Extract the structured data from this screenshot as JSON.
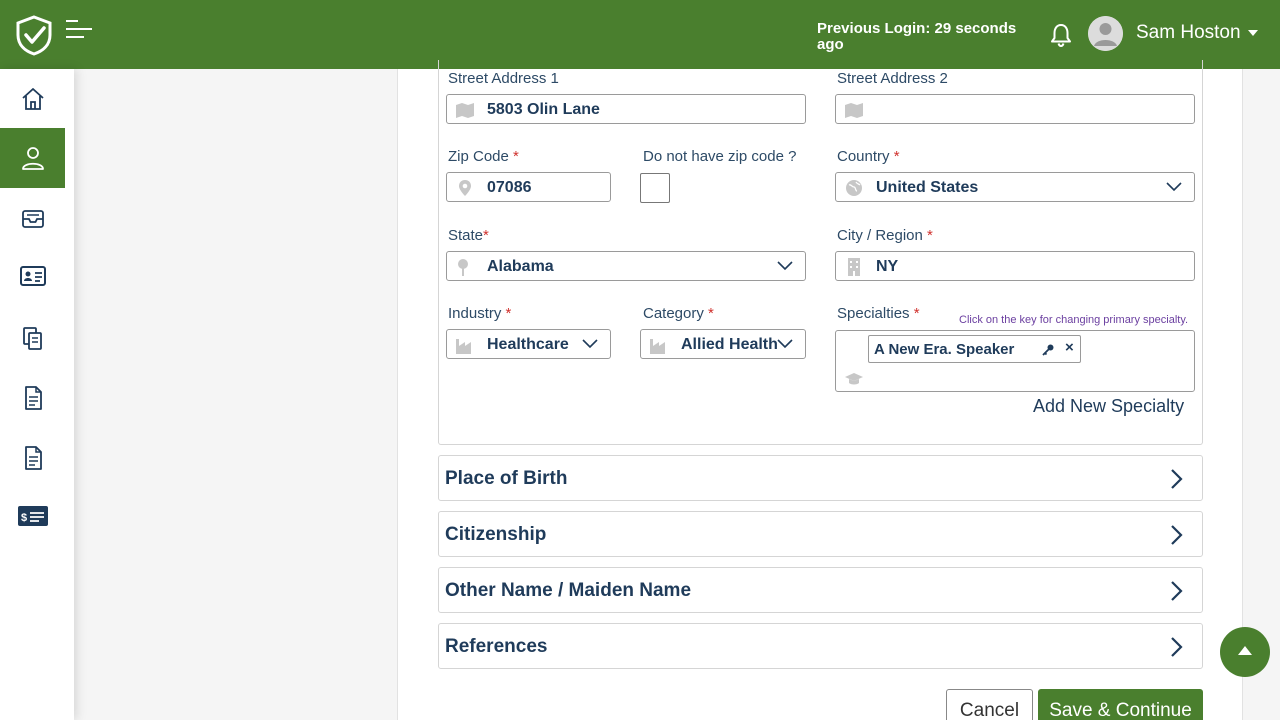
{
  "header": {
    "previous_login": "Previous Login: 29 seconds ago",
    "user_name": "Sam Hoston",
    "brand_color": "#4a7f2e"
  },
  "sidebar": {
    "items": [
      {
        "icon": "home-icon",
        "active": false
      },
      {
        "icon": "user-icon",
        "active": true
      },
      {
        "icon": "inbox-icon",
        "active": false
      },
      {
        "icon": "id-card-icon",
        "active": false
      },
      {
        "icon": "documents-icon",
        "active": false
      },
      {
        "icon": "file-icon",
        "active": false
      },
      {
        "icon": "file-icon",
        "active": false
      },
      {
        "icon": "payment-card-icon",
        "active": false
      }
    ]
  },
  "form": {
    "street1": {
      "label": "Street Address 1",
      "value": "5803 Olin Lane"
    },
    "street2": {
      "label": "Street Address 2",
      "value": ""
    },
    "zip": {
      "label": "Zip Code",
      "required": "*",
      "value": "07086"
    },
    "no_zip": {
      "label": "Do not have zip code ?"
    },
    "country": {
      "label": "Country",
      "required": "*",
      "value": "United States"
    },
    "state": {
      "label": "State",
      "required": "*",
      "value": "Alabama"
    },
    "city": {
      "label": "City / Region",
      "required": "*",
      "value": "NY"
    },
    "industry": {
      "label": "Industry",
      "required": "*",
      "value": "Healthcare"
    },
    "category": {
      "label": "Category",
      "required": "*",
      "value": "Allied Health"
    },
    "specialties": {
      "label": "Specialties",
      "required": "*",
      "hint": "Click on the key for changing primary specialty.",
      "tags": [
        "A New Era. Speaker"
      ],
      "remove": "×",
      "add_label": "Add New Specialty"
    }
  },
  "sections": [
    "Place of Birth",
    "Citizenship",
    "Other Name / Maiden Name",
    "References"
  ],
  "buttons": {
    "cancel": "Cancel",
    "save": "Save & Continue"
  }
}
